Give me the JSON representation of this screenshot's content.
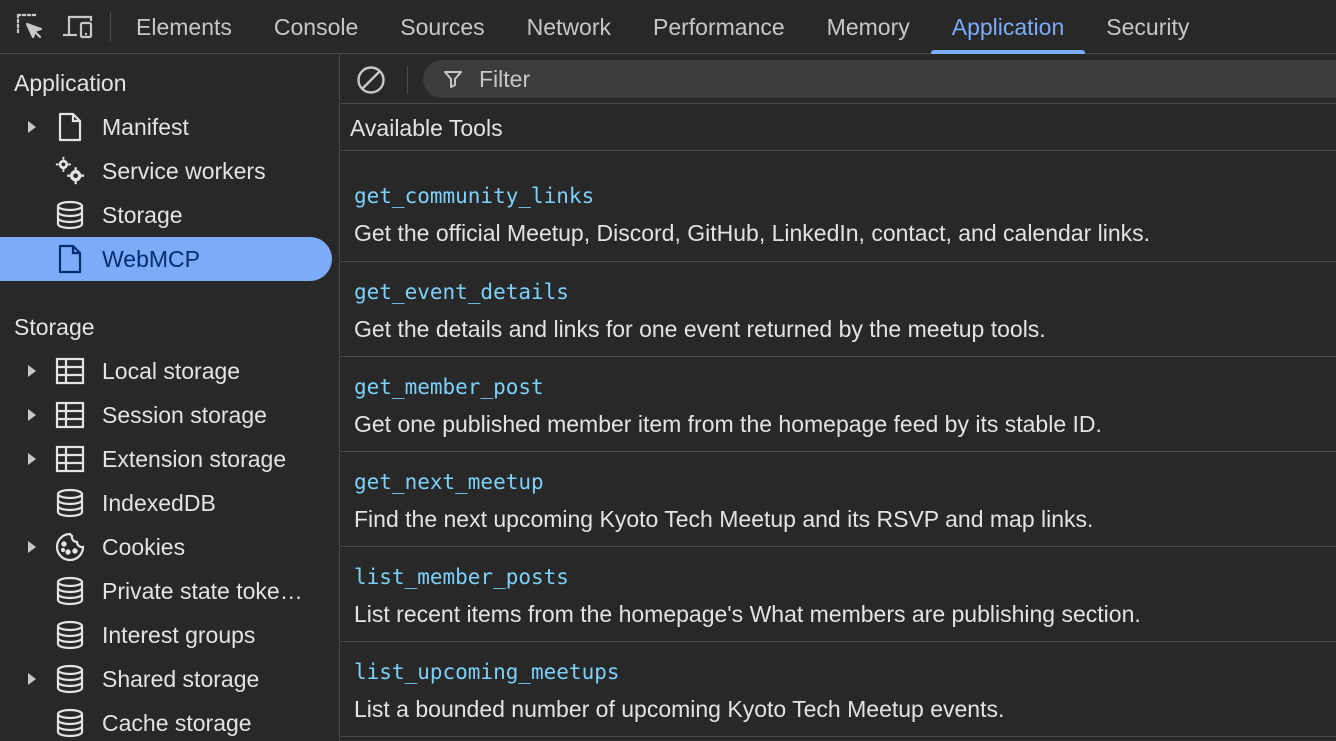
{
  "toolbar": {
    "inspect_icon": "inspect-element-icon",
    "device_icon": "device-toolbar-icon"
  },
  "tabs": [
    {
      "label": "Elements",
      "active": false
    },
    {
      "label": "Console",
      "active": false
    },
    {
      "label": "Sources",
      "active": false
    },
    {
      "label": "Network",
      "active": false
    },
    {
      "label": "Performance",
      "active": false
    },
    {
      "label": "Memory",
      "active": false
    },
    {
      "label": "Application",
      "active": true
    },
    {
      "label": "Security",
      "active": false
    }
  ],
  "sidebar": {
    "application_title": "Application",
    "application_items": [
      {
        "label": "Manifest",
        "icon": "file-icon",
        "expandable": true
      },
      {
        "label": "Service workers",
        "icon": "gears-icon",
        "expandable": false
      },
      {
        "label": "Storage",
        "icon": "database-icon",
        "expandable": false
      },
      {
        "label": "WebMCP",
        "icon": "file-icon",
        "expandable": false,
        "selected": true
      }
    ],
    "storage_title": "Storage",
    "storage_items": [
      {
        "label": "Local storage",
        "icon": "table-icon",
        "expandable": true
      },
      {
        "label": "Session storage",
        "icon": "table-icon",
        "expandable": true
      },
      {
        "label": "Extension storage",
        "icon": "table-icon",
        "expandable": true
      },
      {
        "label": "IndexedDB",
        "icon": "database-icon",
        "expandable": false
      },
      {
        "label": "Cookies",
        "icon": "cookie-icon",
        "expandable": true
      },
      {
        "label": "Private state toke…",
        "icon": "database-icon",
        "expandable": false
      },
      {
        "label": "Interest groups",
        "icon": "database-icon",
        "expandable": false
      },
      {
        "label": "Shared storage",
        "icon": "database-icon",
        "expandable": true
      },
      {
        "label": "Cache storage",
        "icon": "database-icon",
        "expandable": false
      }
    ]
  },
  "main": {
    "filter": {
      "placeholder": "Filter",
      "value": ""
    },
    "header": "Available Tools",
    "tools": [
      {
        "name": "get_community_links",
        "description": "Get the official Meetup, Discord, GitHub, LinkedIn, contact, and calendar links."
      },
      {
        "name": "get_event_details",
        "description": "Get the details and links for one event returned by the meetup tools."
      },
      {
        "name": "get_member_post",
        "description": "Get one published member item from the homepage feed by its stable ID."
      },
      {
        "name": "get_next_meetup",
        "description": "Find the next upcoming Kyoto Tech Meetup and its RSVP and map links."
      },
      {
        "name": "list_member_posts",
        "description": "List recent items from the homepage's What members are publishing section."
      },
      {
        "name": "list_upcoming_meetups",
        "description": "List a bounded number of upcoming Kyoto Tech Meetup events."
      }
    ]
  },
  "colors": {
    "accent": "#7cacf8",
    "tool_name": "#7cd1f9",
    "background": "#282828",
    "selected_text": "#062e6f"
  }
}
